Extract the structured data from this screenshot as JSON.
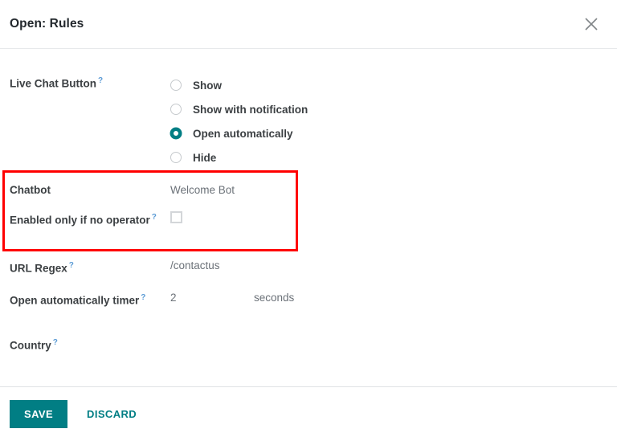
{
  "dialog": {
    "title": "Open: Rules",
    "close_icon": "close-icon"
  },
  "colors": {
    "accent_teal": "#017e84",
    "help_blue": "#5b9bd5",
    "annotation_red": "#ff0000",
    "label_text": "#3c4043",
    "value_text": "#6b7178"
  },
  "fields": {
    "live_chat_button": {
      "label": "Live Chat Button",
      "help": "?",
      "options": [
        {
          "label": "Show",
          "selected": false
        },
        {
          "label": "Show with notification",
          "selected": false
        },
        {
          "label": "Open automatically",
          "selected": true
        },
        {
          "label": "Hide",
          "selected": false
        }
      ]
    },
    "chatbot": {
      "label": "Chatbot",
      "value": "Welcome Bot"
    },
    "enabled_only_if_no_operator": {
      "label": "Enabled only if no operator",
      "help": "?",
      "checked": false
    },
    "url_regex": {
      "label": "URL Regex",
      "help": "?",
      "value": "/contactus"
    },
    "open_automatically_timer": {
      "label": "Open automatically timer",
      "help": "?",
      "value": "2",
      "suffix": "seconds"
    },
    "country": {
      "label": "Country",
      "help": "?",
      "value": ""
    }
  },
  "footer": {
    "save_label": "SAVE",
    "discard_label": "DISCARD"
  }
}
